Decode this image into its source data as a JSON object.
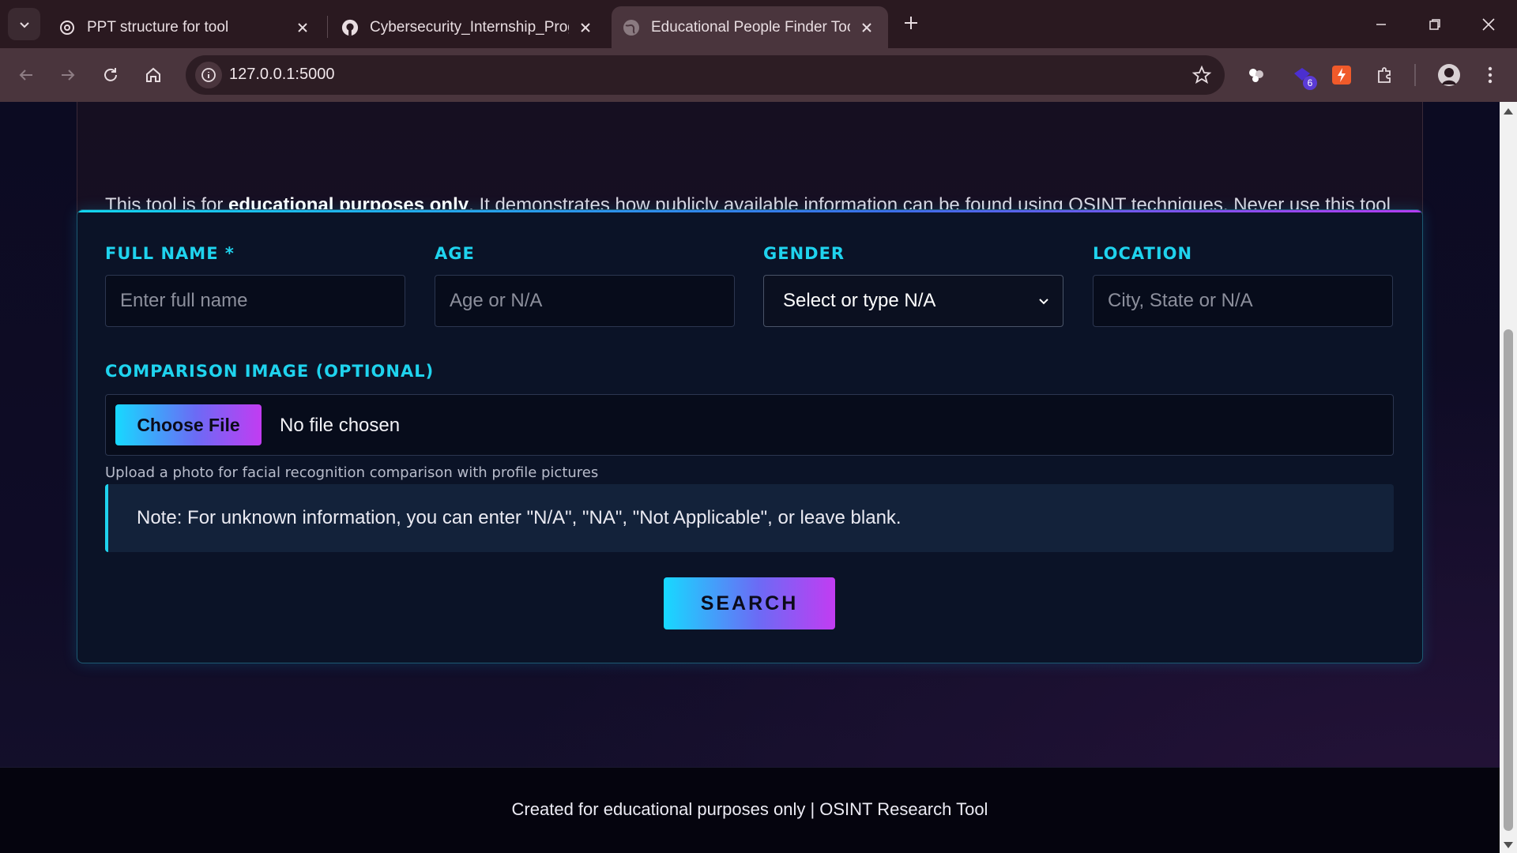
{
  "browser": {
    "tabs": [
      {
        "title": "PPT structure for tool",
        "icon": "openai-icon",
        "active": false
      },
      {
        "title": "Cybersecurity_Internship_Progr",
        "icon": "github-icon",
        "active": false
      },
      {
        "title": "Educational People Finder Tool",
        "icon": "globe-icon",
        "active": true
      }
    ],
    "url": "127.0.0.1:5000",
    "extension_badge": "6"
  },
  "disclaimer": {
    "prefix": "This tool is for ",
    "bold": "educational purposes only",
    "suffix": ". It demonstrates how publicly available information can be found using OSINT techniques. Never use this tool to invade privacy, harass individuals, or for any illegal activities."
  },
  "form": {
    "full_name": {
      "label": "FULL NAME *",
      "placeholder": "Enter full name",
      "value": ""
    },
    "age": {
      "label": "AGE",
      "placeholder": "Age or N/A",
      "value": ""
    },
    "gender": {
      "label": "GENDER",
      "selected": "Select or type N/A"
    },
    "location": {
      "label": "LOCATION",
      "placeholder": "City, State or N/A",
      "value": ""
    },
    "image": {
      "label": "COMPARISON IMAGE (OPTIONAL)",
      "button": "Choose File",
      "status": "No file chosen",
      "help": "Upload a photo for facial recognition comparison with profile pictures"
    },
    "note": "Note: For unknown information, you can enter \"N/A\", \"NA\", \"Not Applicable\", or leave blank.",
    "submit": "SEARCH"
  },
  "footer": {
    "text": "Created for educational purposes only | OSINT Research Tool"
  },
  "colors": {
    "accent_cyan": "#1fd3ee",
    "accent_purple": "#c23cf2",
    "page_bg": "#0c0b22"
  }
}
